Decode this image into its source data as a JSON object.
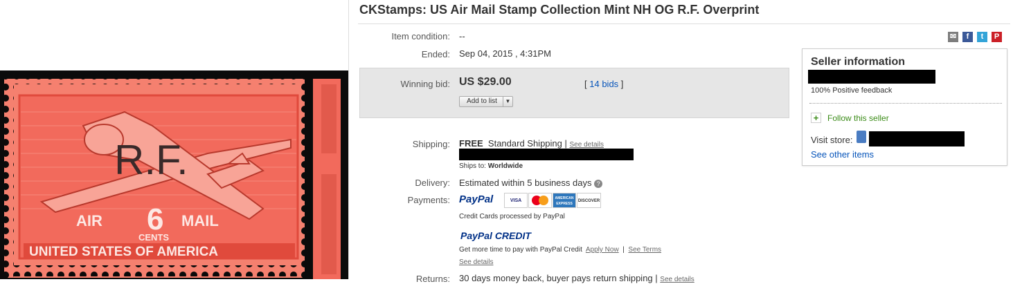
{
  "title": "CKStamps: US Air Mail Stamp Collection Mint NH OG R.F. Overprint",
  "stamp": {
    "overprint": "R.F.",
    "air": "AIR",
    "value": "6",
    "mail": "MAIL",
    "cents": "CENTS",
    "country": "UNITED STATES OF AMERICA"
  },
  "details": {
    "condition_label": "Item condition:",
    "condition_value": "--",
    "ended_label": "Ended:",
    "ended_value": "Sep 04, 2015 , 4:31PM",
    "winning_bid_label": "Winning bid:",
    "winning_bid_value": "US $29.00",
    "bids_open": "[",
    "bids_link": "14 bids",
    "bids_close": "]",
    "add_to_list": "Add to list",
    "shipping_label": "Shipping:",
    "shipping_free": "FREE",
    "shipping_method": "Standard Shipping |",
    "see_details": "See details",
    "ships_to_label": "Ships to:",
    "ships_to_value": "Worldwide",
    "delivery_label": "Delivery:",
    "delivery_value": "Estimated within 5 business days",
    "payments_label": "Payments:",
    "paypal": "PayPal",
    "cards": [
      "VISA",
      "MasterCard",
      "AMERICAN EXPRESS",
      "DISCOVER"
    ],
    "credit_note": "Credit Cards processed by PayPal",
    "paypal_credit": "PayPal CREDIT",
    "credit_text": "Get more time to pay with PayPal Credit",
    "apply_now": "Apply Now",
    "separator": "|",
    "see_terms": "See Terms",
    "see_details2": "See details",
    "returns_label": "Returns:",
    "returns_value": "30 days money back, buyer pays return shipping |",
    "returns_details": "See details"
  },
  "seller": {
    "title": "Seller information",
    "feedback": "100% Positive feedback",
    "follow": "Follow this seller",
    "visit_store": "Visit store:",
    "see_other": "See other items"
  },
  "share_icons": [
    "email-icon",
    "facebook-icon",
    "twitter-icon",
    "pinterest-icon"
  ],
  "colors": {
    "link": "#0654ba",
    "stamp": "#f26a5c",
    "paypal_dark": "#003087",
    "paypal_light": "#009cde",
    "follow_green": "#3a8b17"
  }
}
